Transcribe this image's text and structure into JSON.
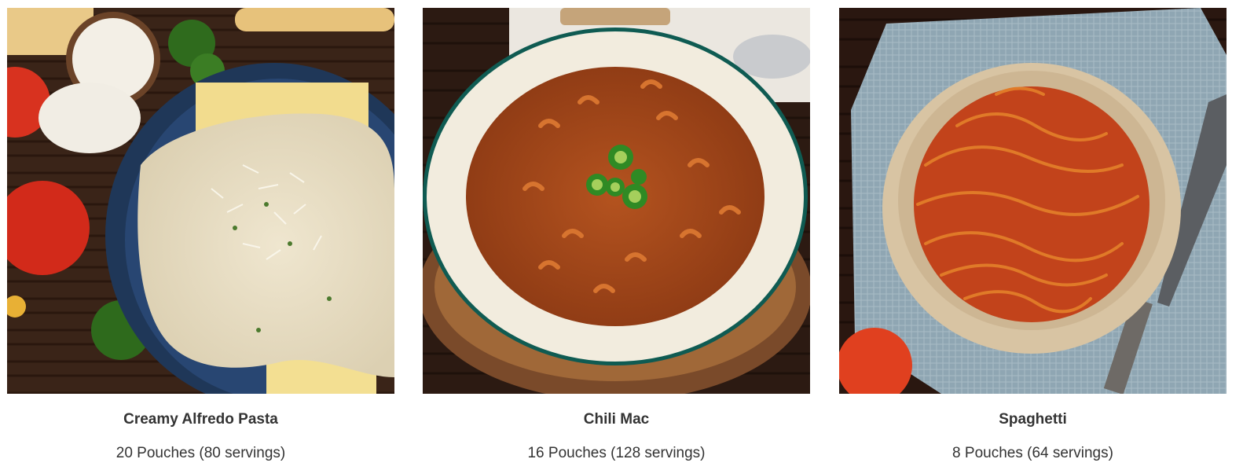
{
  "products": [
    {
      "name": "Creamy Alfredo Pasta",
      "servings": "20 Pouches (80 servings)",
      "image": "creamy-alfredo-pasta-photo"
    },
    {
      "name": "Chili Mac",
      "servings": "16 Pouches (128 servings)",
      "image": "chili-mac-photo"
    },
    {
      "name": "Spaghetti",
      "servings": "8 Pouches (64 servings)",
      "image": "spaghetti-photo"
    }
  ],
  "colors": {
    "text": "#333333",
    "background": "#ffffff"
  }
}
